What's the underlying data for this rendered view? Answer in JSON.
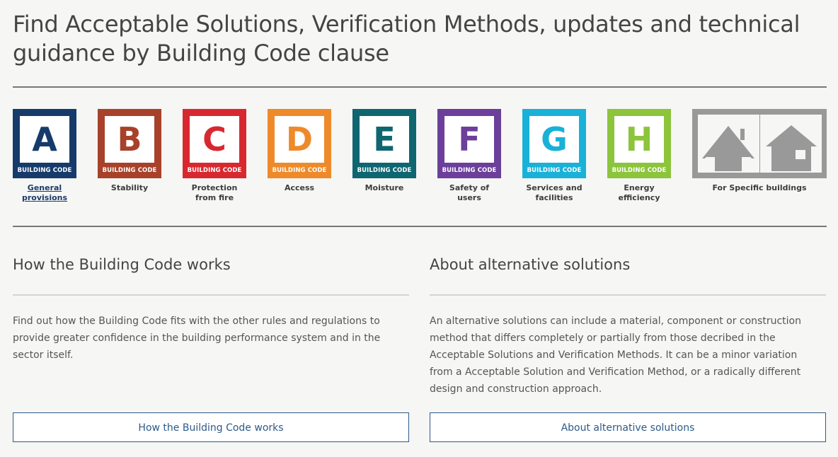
{
  "header": {
    "title_line1": "Find Acceptable Solutions, Verification Methods, updates and technical",
    "title_line2": "guidance by Building Code clause"
  },
  "clauses": [
    {
      "letter": "A",
      "code": "BUILDING CODE",
      "label1": "General",
      "label2": "provisions",
      "color": "#163b6b",
      "active": true
    },
    {
      "letter": "B",
      "code": "BUILDING CODE",
      "label1": "Stability",
      "label2": "",
      "color": "#a8412a",
      "active": false
    },
    {
      "letter": "C",
      "code": "BUILDING CODE",
      "label1": "Protection",
      "label2": "from fire",
      "color": "#d8282f",
      "active": false
    },
    {
      "letter": "D",
      "code": "BUILDING CODE",
      "label1": "Access",
      "label2": "",
      "color": "#ee8a2a",
      "active": false
    },
    {
      "letter": "E",
      "code": "BUILDING CODE",
      "label1": "Moisture",
      "label2": "",
      "color": "#0e6670",
      "active": false
    },
    {
      "letter": "F",
      "code": "BUILDING CODE",
      "label1": "Safety of",
      "label2": "users",
      "color": "#6b3f9a",
      "active": false
    },
    {
      "letter": "G",
      "code": "BUILDING CODE",
      "label1": "Services and",
      "label2": "facilities",
      "color": "#1ab1d8",
      "active": false
    },
    {
      "letter": "H",
      "code": "BUILDING CODE",
      "label1": "Energy",
      "label2": "efficiency",
      "color": "#8cc43c",
      "active": false
    }
  ],
  "specific": {
    "label": "For Specific buildings",
    "icons": [
      "house-roof-icon",
      "house-garage-icon"
    ],
    "color": "#999999"
  },
  "sections": [
    {
      "title": "How the Building Code works",
      "text": "Find out how the Building Code fits with the other rules and regulations to provide greater confidence in the building performance system and in the sector itself.",
      "button": "How the Building Code works"
    },
    {
      "title": "About alternative solutions",
      "text": "An alternative solutions can include a material, component or construction method that differs completely or partially from those decribed in the Acceptable Solutions and Verification Methods.  It can be a minor  variation from a Acceptable Solution and Verification Method, or a radically different design and construction approach.",
      "button": "About alternative solutions"
    }
  ]
}
